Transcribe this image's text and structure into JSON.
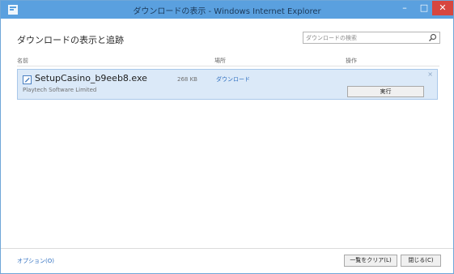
{
  "window": {
    "title": "ダウンロードの表示 - Windows Internet Explorer",
    "minimize_symbol": "–",
    "maximize_symbol": "□",
    "close_symbol": "✕"
  },
  "header": {
    "title": "ダウンロードの表示と追跡"
  },
  "search": {
    "placeholder": "ダウンロードの検索",
    "icon": "search-icon"
  },
  "columns": {
    "name": "名前",
    "location": "場所",
    "actions": "操作"
  },
  "downloads": [
    {
      "file_name": "SetupCasino_b9eeb8.exe",
      "publisher": "Playtech Software Limited",
      "size": "268 KB",
      "location": "ダウンロード",
      "action_label": "実行",
      "dismiss_symbol": "×"
    }
  ],
  "footer": {
    "options_link": "オプション(O)",
    "clear_list_button": "一覧をクリア(L)",
    "close_button": "閉じる(C)"
  },
  "colors": {
    "titlebar": "#5aa0df",
    "close_button": "#d7463f",
    "row_highlight": "#dbe9f8",
    "link": "#2f6fc0"
  }
}
